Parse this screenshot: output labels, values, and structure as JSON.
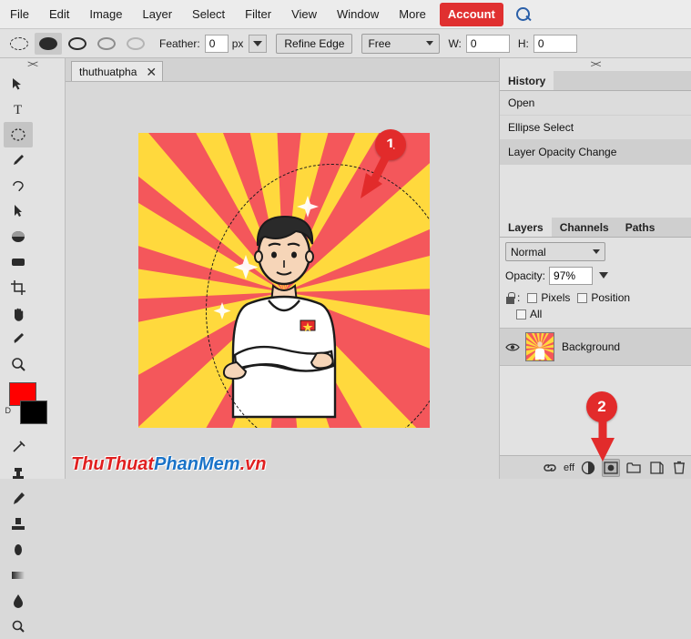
{
  "menubar": {
    "items": [
      {
        "label": "File"
      },
      {
        "label": "Edit"
      },
      {
        "label": "Image"
      },
      {
        "label": "Layer"
      },
      {
        "label": "Select"
      },
      {
        "label": "Filter"
      },
      {
        "label": "View"
      },
      {
        "label": "Window"
      },
      {
        "label": "More"
      }
    ],
    "account_label": "Account",
    "search_icon": "search-icon"
  },
  "optionsbar": {
    "feather_label": "Feather:",
    "feather_value": "0",
    "feather_unit": "px",
    "refine_edge_label": "Refine Edge",
    "style_value": "Free",
    "width_label": "W:",
    "width_value": "0",
    "height_label": "H:",
    "height_value": "0"
  },
  "toolbar": {
    "grip": "><",
    "tools": [
      {
        "name": "move-tool"
      },
      {
        "name": "type-tool"
      },
      {
        "name": "elliptical-marquee-tool"
      },
      {
        "name": "brush-tool"
      },
      {
        "name": "lasso-tool"
      },
      {
        "name": "path-selection-tool"
      },
      {
        "name": "gradient-ellipse-tool"
      },
      {
        "name": "rectangle-tool"
      },
      {
        "name": "crop-tool"
      },
      {
        "name": "hand-tool"
      },
      {
        "name": "eyedropper-tool"
      },
      {
        "name": "zoom-tool"
      }
    ],
    "tools2": [
      {
        "name": "healing-brush-tool"
      },
      {
        "name": "clone-stamp-tool"
      },
      {
        "name": "paint-brush-tool"
      },
      {
        "name": "stamp-tool"
      },
      {
        "name": "eraser-tool"
      },
      {
        "name": "gradient-tool"
      },
      {
        "name": "blur-tool"
      },
      {
        "name": "dodge-tool"
      }
    ],
    "foreground_color": "#ff0000",
    "background_color": "#000000",
    "swap_label": "D"
  },
  "document": {
    "tab_title": "thuthuatpha",
    "close_label": "✕"
  },
  "canvas": {
    "watermark_prefix": "ThuThuat",
    "watermark_mid": "PhanMem",
    "watermark_suffix": ".vn",
    "selection_shape": "ellipse-marching-ants"
  },
  "history_panel": {
    "grip": "><",
    "tab_label": "History",
    "items": [
      {
        "label": "Open",
        "selected": false
      },
      {
        "label": "Ellipse Select",
        "selected": false
      },
      {
        "label": "Layer Opacity Change",
        "selected": true
      }
    ]
  },
  "layers_panel": {
    "tabs": [
      {
        "label": "Layers",
        "active": true
      },
      {
        "label": "Channels",
        "active": false
      },
      {
        "label": "Paths",
        "active": false
      }
    ],
    "blend_mode": "Normal",
    "opacity_label": "Opacity:",
    "opacity_value": "97%",
    "lock_label": ":",
    "lock_pixels_label": "Pixels",
    "lock_position_label": "Position",
    "lock_all_label": "All",
    "layers": [
      {
        "name": "Background",
        "visible": true
      }
    ],
    "footer": {
      "link_label": "link-layers-icon",
      "effects_label": "eff",
      "adjustment_label": "adjustment-layer-icon",
      "mask_label": "add-layer-mask-icon",
      "group_label": "new-group-icon",
      "new_layer_label": "new-layer-icon",
      "delete_label": "delete-layer-icon"
    }
  },
  "annotations": [
    {
      "number": "1",
      "target": "canvas-selection"
    },
    {
      "number": "2",
      "target": "add-layer-mask-button"
    }
  ]
}
